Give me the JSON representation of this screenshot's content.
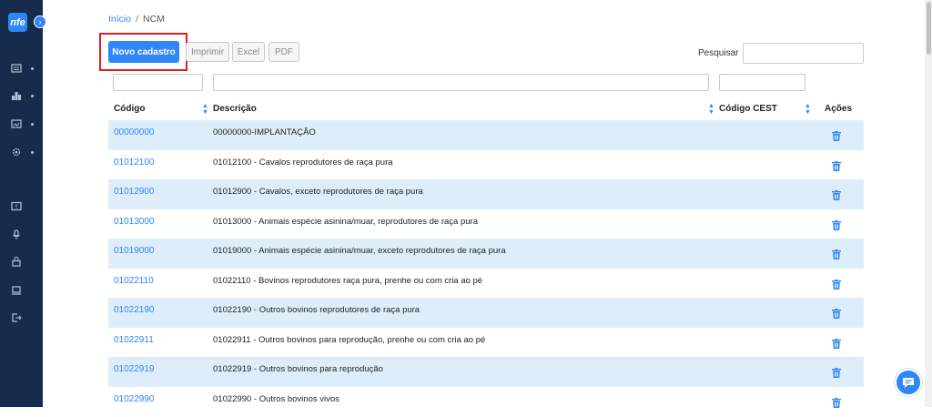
{
  "sidebar": {
    "logo": "nfe",
    "toggle_icon": "chevron-right-icon",
    "items": [
      {
        "icon": "list-icon"
      },
      {
        "icon": "bar-chart-icon"
      },
      {
        "icon": "image-folder-icon"
      },
      {
        "icon": "gear-icon"
      },
      {
        "icon": "chat-alert-icon"
      },
      {
        "icon": "microphone-icon"
      },
      {
        "icon": "lock-icon"
      },
      {
        "icon": "laptop-icon"
      },
      {
        "icon": "logout-icon"
      }
    ]
  },
  "breadcrumb": {
    "home": "Início",
    "separator": "/",
    "current": "NCM"
  },
  "toolbar": {
    "new_label": "Novo cadastro",
    "print_label": "Imprimir",
    "excel_label": "Excel",
    "pdf_label": "PDF"
  },
  "search": {
    "label": "Pesquisar",
    "value": ""
  },
  "table": {
    "columns": [
      "Código",
      "Descrição",
      "Código CEST",
      "Ações"
    ],
    "rows": [
      {
        "code": "00000000",
        "desc": "00000000-IMPLANTAÇÃO",
        "cest": ""
      },
      {
        "code": "01012100",
        "desc": "01012100 - Cavalos reprodutores de raça pura",
        "cest": ""
      },
      {
        "code": "01012900",
        "desc": "01012900 - Cavalos, exceto reprodutores de raça pura",
        "cest": ""
      },
      {
        "code": "01013000",
        "desc": "01013000 - Animais espécie asinina/muar, reprodutores de raça pura",
        "cest": ""
      },
      {
        "code": "01019000",
        "desc": "01019000 - Animais espécie asinina/muar, exceto reprodutores de raça pura",
        "cest": ""
      },
      {
        "code": "01022110",
        "desc": "01022110 - Bovinos reprodutores raça pura, prenhe ou com cria ao pé",
        "cest": ""
      },
      {
        "code": "01022190",
        "desc": "01022190 - Outros bovinos reprodutores de raça pura",
        "cest": ""
      },
      {
        "code": "01022911",
        "desc": "01022911 - Outros bovinos para reprodução, prenhe ou com cria ao pé",
        "cest": ""
      },
      {
        "code": "01022919",
        "desc": "01022919 - Outros bovinos para reprodução",
        "cest": ""
      },
      {
        "code": "01022990",
        "desc": "01022990 - Outros bovinos vivos",
        "cest": ""
      }
    ]
  },
  "colors": {
    "accent": "#2f86f6",
    "sidebar": "#172b4d",
    "row_alt": "#ddeefa",
    "highlight": "#e01b24"
  }
}
